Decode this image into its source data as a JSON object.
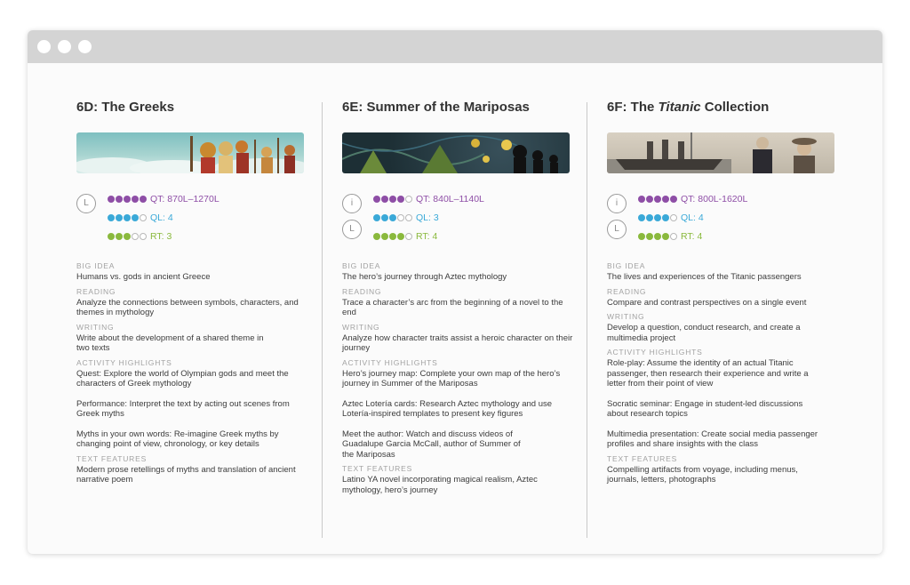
{
  "columns": [
    {
      "title": "6D: The Greeks",
      "measures": [
        {
          "label": "QT:",
          "value": "870L–1270L",
          "filled": 5
        },
        {
          "label": "QL:",
          "value": "4",
          "filled": 4
        },
        {
          "label": "RT:",
          "value": "3",
          "filled": 3
        }
      ],
      "badges": [
        "L"
      ],
      "big_idea_head": "BIG IDEA",
      "big_idea": "Humans vs. gods in ancient Greece",
      "reading_head": "READING",
      "reading": "Analyze the connections between symbols, characters, and themes in mythology",
      "writing_head": "WRITING",
      "writing": "Write about the development of a shared theme in two texts",
      "activity_head": "ACTIVITY HIGHLIGHTS",
      "activities": [
        "Quest: Explore the world of Olympian gods and meet the characters of Greek mythology",
        "Performance: Interpret the text by acting out scenes from Greek myths",
        "Myths in your own words: Re-imagine Greek myths by changing point of view, chronology, or key details"
      ],
      "text_features_head": "TEXT FEATURES",
      "text_features": "Modern prose retellings of myths and translation of ancient narrative poem"
    },
    {
      "title": "6E: Summer of the Mariposas",
      "measures": [
        {
          "label": "QT:",
          "value": "840L–1140L",
          "filled": 4
        },
        {
          "label": "QL:",
          "value": "3",
          "filled": 3
        },
        {
          "label": "RT:",
          "value": "4",
          "filled": 4
        }
      ],
      "badges": [
        "i",
        "L"
      ],
      "big_idea_head": "BIG IDEA",
      "big_idea": "The hero’s journey through Aztec mythology",
      "reading_head": "READING",
      "reading": "Trace a character’s arc from the beginning of a novel to the end",
      "writing_head": "WRITING",
      "writing": "Analyze how character traits assist a heroic character on their journey",
      "activity_head": "ACTIVITY HIGHLIGHTS",
      "activities": [
        "Hero’s journey map: Complete your own map of the hero’s journey in Summer of the Mariposas",
        "Aztec Lotería cards: Research Aztec mythology and use Lotería-inspired templates to present key figures",
        "Meet the author: Watch and discuss videos of Guadalupe Garcia McCall, author of Summer of the Mariposas"
      ],
      "text_features_head": "TEXT FEATURES",
      "text_features": "Latino YA novel incorporating magical realism, Aztec mythology, hero’s journey"
    },
    {
      "title_prefix": "6F: The ",
      "title_italic": "Titanic",
      "title_suffix": " Collection",
      "measures": [
        {
          "label": "QT:",
          "value": "800L-1620L",
          "filled": 5
        },
        {
          "label": "QL:",
          "value": "4",
          "filled": 4
        },
        {
          "label": "RT:",
          "value": "4",
          "filled": 4
        }
      ],
      "badges": [
        "i",
        "L"
      ],
      "big_idea_head": "BIG IDEA",
      "big_idea": "The lives and experiences of the Titanic passengers",
      "reading_head": "READING",
      "reading": "Compare and contrast perspectives on a single event",
      "writing_head": "WRITING",
      "writing": "Develop a question, conduct research, and create a multimedia project",
      "activity_head": "ACTIVITY HIGHLIGHTS",
      "activities": [
        "Role-play: Assume the identity of an actual Titanic passenger, then research their experience and write a letter from their point of view",
        "Socratic seminar: Engage in student-led discussions about research topics",
        "Multimedia presentation: Create social media passenger profiles and share insights with the class"
      ],
      "text_features_head": "TEXT FEATURES",
      "text_features": "Compelling artifacts from voyage, including menus, journals, letters, photographs"
    }
  ],
  "colors": {
    "qt": "#8e4ea6",
    "ql": "#3aa9d8",
    "rt": "#8ab93d"
  }
}
